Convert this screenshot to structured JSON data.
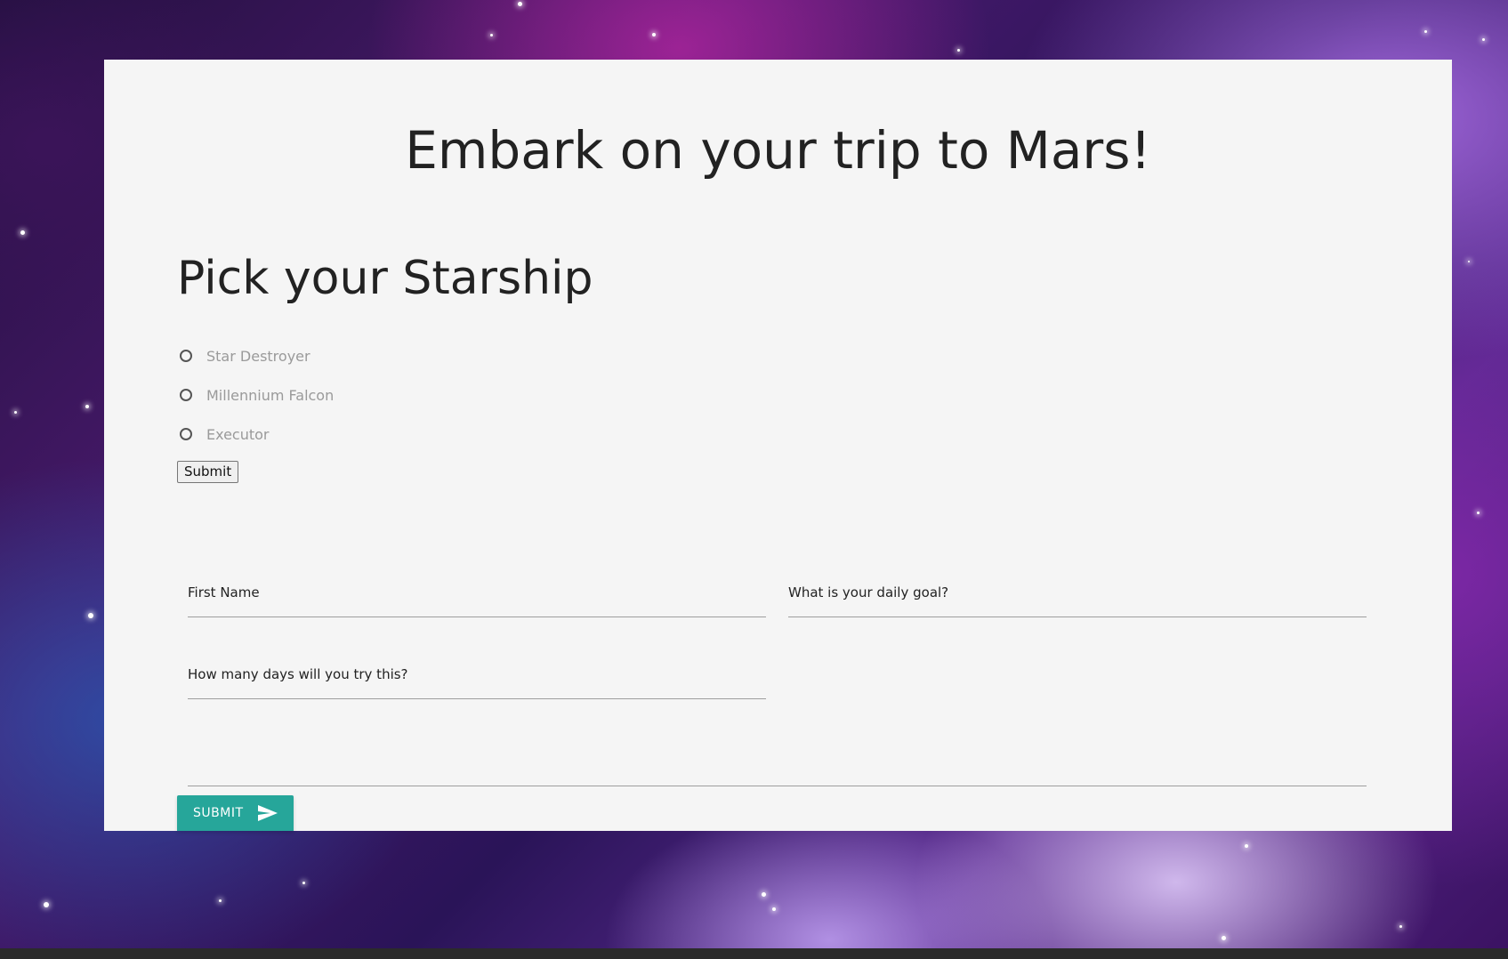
{
  "page": {
    "title": "Embark on your trip to Mars!"
  },
  "starship": {
    "heading": "Pick your Starship",
    "options": [
      {
        "label": "Star Destroyer",
        "selected": false
      },
      {
        "label": "Millennium Falcon",
        "selected": false
      },
      {
        "label": "Executor",
        "selected": false
      }
    ],
    "submit_label": "Submit"
  },
  "form": {
    "first_name_label": "First Name",
    "daily_goal_label": "What is your daily goal?",
    "days_label": "How many days will you try this?",
    "submit_label": "Submit",
    "submit_icon": "send-icon"
  },
  "colors": {
    "card_background": "#f5f5f5",
    "accent": "#26a69a",
    "text": "#222222",
    "muted_text": "#9a9a9a"
  }
}
